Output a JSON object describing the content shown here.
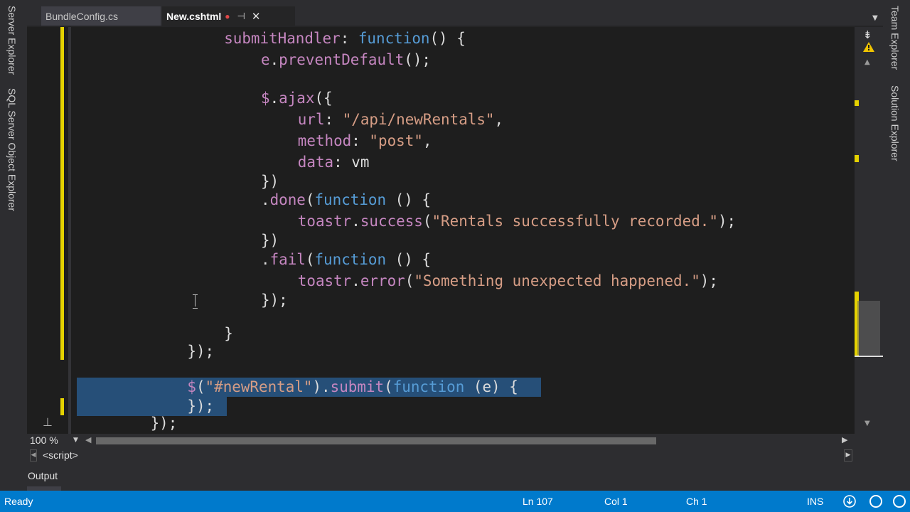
{
  "left_panel": {
    "tabs": [
      "Server Explorer",
      "SQL Server Object Explorer"
    ]
  },
  "right_panel": {
    "tabs": [
      "Team Explorer",
      "Solution Explorer"
    ]
  },
  "tabs": [
    {
      "label": "BundleConfig.cs",
      "active": false
    },
    {
      "label": "New.cshtml",
      "active": true,
      "dirty_marker": "●",
      "pin_glyph": "⊣",
      "close_glyph": "✕"
    }
  ],
  "editor": {
    "lines": [
      {
        "indent": 8,
        "tokens": [
          [
            "p",
            "submitHandler"
          ],
          [
            "",
            ": "
          ],
          [
            "k",
            "function"
          ],
          [
            "",
            "() {"
          ]
        ]
      },
      {
        "indent": 10,
        "tokens": [
          [
            "p",
            "e"
          ],
          [
            "",
            "."
          ],
          [
            "p",
            "preventDefault"
          ],
          [
            "",
            "();"
          ]
        ]
      },
      {
        "indent": 0,
        "tokens": []
      },
      {
        "indent": 10,
        "tokens": [
          [
            "p",
            "$"
          ],
          [
            "",
            "."
          ],
          [
            "p",
            "ajax"
          ],
          [
            "",
            "({"
          ]
        ]
      },
      {
        "indent": 12,
        "tokens": [
          [
            "p",
            "url"
          ],
          [
            "",
            ": "
          ],
          [
            "s",
            "\"/api/newRentals\""
          ],
          [
            "",
            ","
          ]
        ]
      },
      {
        "indent": 12,
        "tokens": [
          [
            "p",
            "method"
          ],
          [
            "",
            ": "
          ],
          [
            "s",
            "\"post\""
          ],
          [
            "",
            ","
          ]
        ]
      },
      {
        "indent": 12,
        "tokens": [
          [
            "p",
            "data"
          ],
          [
            "",
            ": vm"
          ]
        ]
      },
      {
        "indent": 10,
        "tokens": [
          [
            "",
            "})"
          ]
        ]
      },
      {
        "indent": 10,
        "tokens": [
          [
            "",
            "."
          ],
          [
            "p",
            "done"
          ],
          [
            "",
            "("
          ],
          [
            "k",
            "function"
          ],
          [
            "",
            " () {"
          ]
        ]
      },
      {
        "indent": 12,
        "tokens": [
          [
            "p",
            "toastr"
          ],
          [
            "",
            "."
          ],
          [
            "p",
            "success"
          ],
          [
            "",
            "("
          ],
          [
            "s",
            "\"Rentals successfully recorded.\""
          ],
          [
            "",
            ");"
          ]
        ]
      },
      {
        "indent": 10,
        "tokens": [
          [
            "",
            "})"
          ]
        ]
      },
      {
        "indent": 10,
        "tokens": [
          [
            "",
            "."
          ],
          [
            "p",
            "fail"
          ],
          [
            "",
            "("
          ],
          [
            "k",
            "function"
          ],
          [
            "",
            " () {"
          ]
        ]
      },
      {
        "indent": 12,
        "tokens": [
          [
            "p",
            "toastr"
          ],
          [
            "",
            "."
          ],
          [
            "p",
            "error"
          ],
          [
            "",
            "("
          ],
          [
            "s",
            "\"Something unexpected happened.\""
          ],
          [
            "",
            ");"
          ]
        ]
      },
      {
        "indent": 10,
        "tokens": [
          [
            "",
            "});"
          ]
        ]
      },
      {
        "indent": 0,
        "tokens": []
      },
      {
        "indent": 8,
        "tokens": [
          [
            "",
            "}"
          ]
        ]
      },
      {
        "indent": 6,
        "tokens": [
          [
            "",
            "});"
          ]
        ]
      },
      {
        "indent": 0,
        "tokens": []
      },
      {
        "indent": 6,
        "tokens": [
          [
            "p",
            "$"
          ],
          [
            "",
            "("
          ],
          [
            "s",
            "\"#newRental\""
          ],
          [
            "",
            ")."
          ],
          [
            "p",
            "submit"
          ],
          [
            "",
            "("
          ],
          [
            "k",
            "function"
          ],
          [
            "",
            " (e) {"
          ]
        ]
      },
      {
        "indent": 6,
        "tokens": [
          [
            "",
            "});"
          ]
        ]
      },
      {
        "indent": 4,
        "tokens": [
          [
            "",
            "});"
          ]
        ]
      }
    ]
  },
  "zoom": {
    "level": "100 %"
  },
  "navigation": {
    "scope": "<script>"
  },
  "output_panel": {
    "title": "Output"
  },
  "status": {
    "ready": "Ready",
    "line": "Ln 107",
    "col": "Col 1",
    "ch": "Ch 1",
    "mode": "INS"
  },
  "colors": {
    "keyword": "#569cd6",
    "identifier": "#c586c0",
    "string": "#d69d85",
    "status_bar": "#007acc",
    "selection": "#264f78",
    "change_marker": "#e5d200"
  }
}
